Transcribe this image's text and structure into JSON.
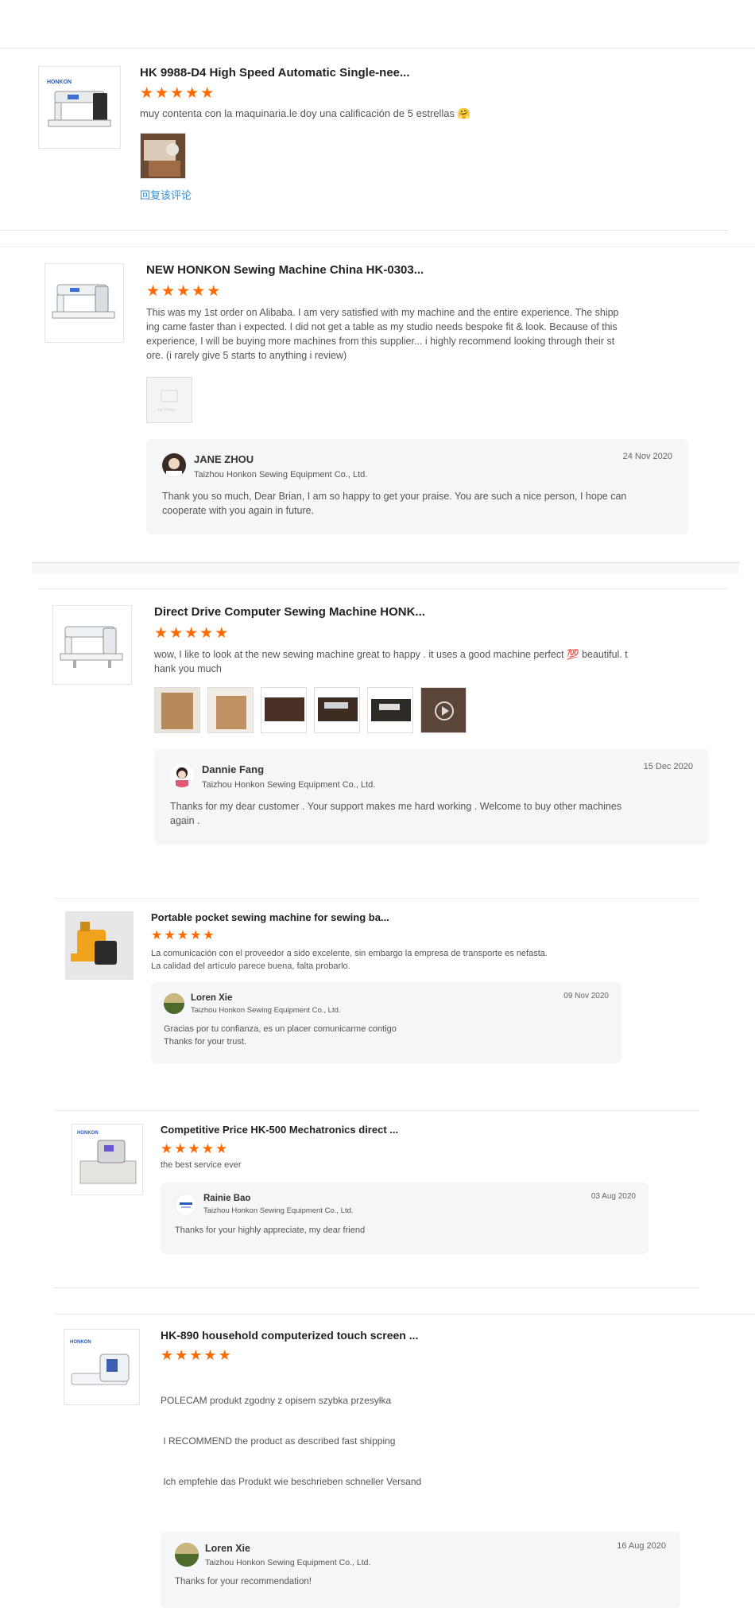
{
  "accent": "#ff6a00",
  "link_color": "#2f8fd8",
  "reviews": [
    {
      "product_title": "HK 9988-D4 High Speed Automatic Single-nee...",
      "rating": 5,
      "text": "muy contenta con la maquinaria.le doy una calificación de 5 estrellas 🤗",
      "images": [
        "sewing-photo"
      ],
      "reply_link": "回复该评论"
    },
    {
      "product_title": "NEW HONKON Sewing Machine China HK-0303...",
      "rating": 5,
      "text_lines": [
        "This was my 1st order on Alibaba. I am very satisfied with my machine and the entire experience. The shipp",
        "ing came faster than i expected. I did not get a table as my studio needs bespoke fit & look. Because of this",
        "experience, I will be buying more machines from this supplier... i highly recommend looking through their st",
        "ore. (i rarely give 5 starts to anything i review)"
      ],
      "images": [
        "placeholder-image"
      ],
      "reply": {
        "name": "JANE ZHOU",
        "company": "Taizhou Honkon Sewing Equipment Co., Ltd.",
        "date": "24 Nov 2020",
        "text_lines": [
          "Thank you so much, Dear Brian, I am so happy to get your praise. You are such a nice person, I hope can",
          "cooperate with you again in future."
        ]
      }
    },
    {
      "product_title": "Direct Drive Computer Sewing Machine HONK...",
      "rating": 5,
      "text_lines": [
        "wow, I like to look at the new sewing machine great to happy . it uses a good machine perfect 💯 beautiful. t",
        "hank you much"
      ],
      "images": [
        "box-photo",
        "box-photo",
        "machine-photo",
        "machine-photo",
        "machine-photo",
        "video-thumb"
      ],
      "reply": {
        "name": "Dannie Fang",
        "company": "Taizhou Honkon Sewing Equipment Co., Ltd.",
        "date": "15 Dec 2020",
        "text_lines": [
          "Thanks for my dear customer . Your support makes me hard working . Welcome to buy other machines",
          "again ."
        ]
      }
    },
    {
      "product_title": "Portable pocket sewing machine for sewing ba...",
      "rating": 5,
      "text_lines": [
        "La comunicación con el proveedor a sido excelente, sin embargo la empresa de transporte es nefasta.",
        "La calidad del artículo parece buena, falta probarlo."
      ],
      "reply": {
        "name": "Loren Xie",
        "company": "Taizhou Honkon Sewing Equipment Co., Ltd.",
        "date": "09 Nov 2020",
        "text_lines": [
          "Gracias por tu confianza, es un placer comunicarme contigo",
          "Thanks for your trust."
        ]
      }
    },
    {
      "product_title": "Competitive Price HK-500 Mechatronics direct ...",
      "rating": 5,
      "text_lines": [
        "the best service ever"
      ],
      "reply": {
        "name": "Rainie Bao",
        "company": "Taizhou Honkon Sewing Equipment Co., Ltd.",
        "date": "03 Aug 2020",
        "text_lines": [
          "Thanks for your highly appreciate, my dear friend"
        ]
      }
    },
    {
      "product_title": "HK-890 household computerized touch screen ...",
      "rating": 5,
      "text_lines": [
        "POLECAM produkt zgodny z opisem szybka przesyłka",
        " I RECOMMEND the product as described fast shipping",
        " Ich empfehle das Produkt wie beschrieben schneller Versand"
      ],
      "reply": {
        "name": "Loren Xie",
        "company": "Taizhou Honkon Sewing Equipment Co., Ltd.",
        "date": "16 Aug 2020",
        "text_lines": [
          "Thanks for your recommendation!"
        ]
      }
    }
  ]
}
